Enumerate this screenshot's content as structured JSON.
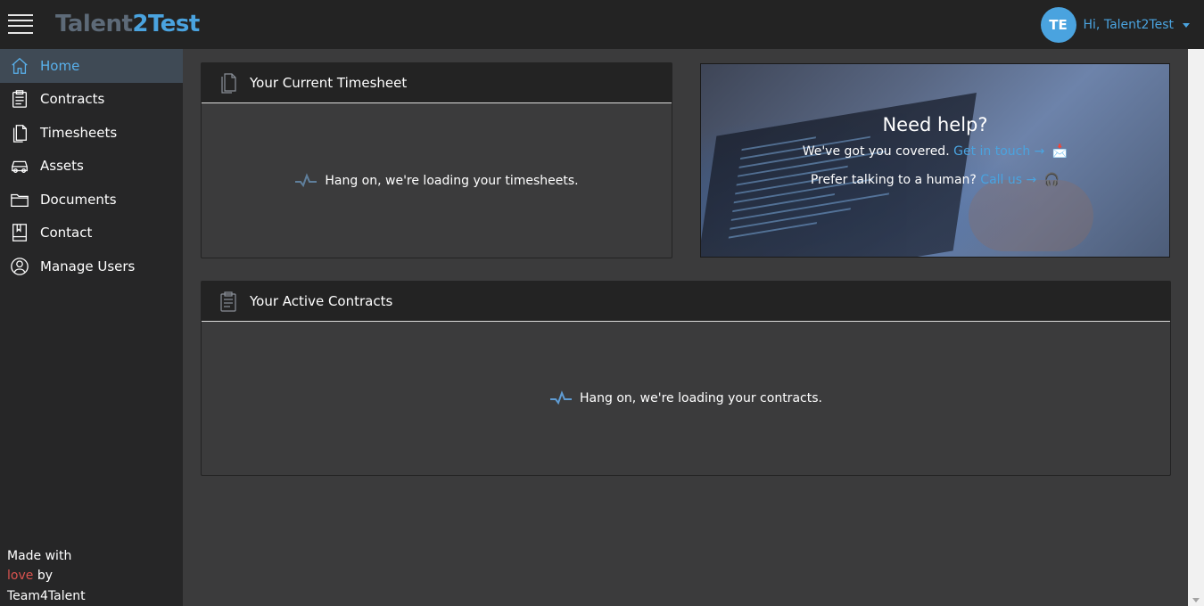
{
  "header": {
    "logo_part1": "Talent",
    "logo_part2": "2Test",
    "avatar_initials": "TE",
    "greeting": "Hi, Talent2Test"
  },
  "sidebar": {
    "items": [
      {
        "label": "Home",
        "icon": "home-icon",
        "active": true
      },
      {
        "label": "Contracts",
        "icon": "clipboard-icon"
      },
      {
        "label": "Timesheets",
        "icon": "documents-icon"
      },
      {
        "label": "Assets",
        "icon": "car-icon"
      },
      {
        "label": "Documents",
        "icon": "folder-icon"
      },
      {
        "label": "Contact",
        "icon": "book-icon"
      },
      {
        "label": "Manage Users",
        "icon": "user-icon"
      }
    ],
    "footer": {
      "line1": "Made with",
      "love": "love",
      "by": "by",
      "team": "Team4Talent"
    }
  },
  "timesheet_card": {
    "title": "Your Current Timesheet",
    "loading": "Hang on, we're loading your timesheets."
  },
  "contracts_card": {
    "title": "Your Active Contracts",
    "loading": "Hang on, we're loading your contracts."
  },
  "help": {
    "title": "Need help?",
    "line1_text": "We've got you covered.",
    "line1_link": "Get in touch →",
    "line1_emoji": "📩",
    "line2_text": "Prefer talking to a human?",
    "line2_link": "Call us →",
    "line2_emoji": "🎧"
  },
  "colors": {
    "accent": "#4aa3df",
    "topbar": "#232323",
    "sidebar": "#262627",
    "content_bg": "#3b3b3c",
    "active_item_bg": "#3f4a55",
    "love": "#d9534f"
  }
}
